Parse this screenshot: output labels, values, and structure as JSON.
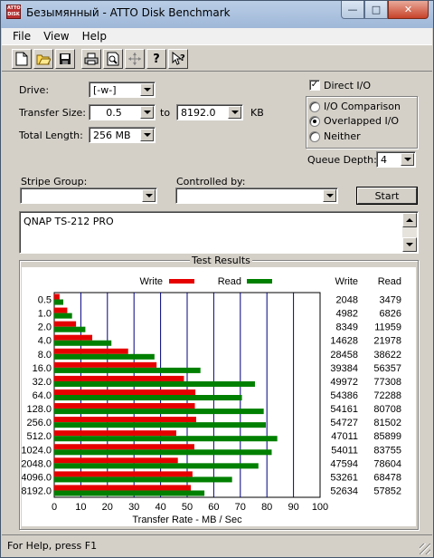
{
  "window": {
    "title": "Безымянный - ATTO Disk Benchmark",
    "icon_text": "ATTO DISK"
  },
  "menu": [
    "File",
    "View",
    "Help"
  ],
  "toolbar": {
    "buttons": [
      "new-icon",
      "open-icon",
      "save-icon",
      "print-icon",
      "print-preview-icon",
      "move-icon",
      "help-icon",
      "context-help-icon"
    ]
  },
  "settings": {
    "drive_label": "Drive:",
    "drive_value": "[-w-]",
    "transfer_size_label": "Transfer Size:",
    "transfer_from": "0.5",
    "to_label": "to",
    "transfer_to": "8192.0",
    "kb_label": "KB",
    "total_length_label": "Total Length:",
    "total_length_value": "256 MB",
    "direct_io_label": "Direct I/O",
    "direct_io_checked": true,
    "io_comparison_label": "I/O Comparison",
    "overlapped_io_label": "Overlapped I/O",
    "neither_label": "Neither",
    "selected_mode": "overlapped",
    "queue_depth_label": "Queue Depth:",
    "queue_depth_value": "4",
    "stripe_group_label": "Stripe Group:",
    "stripe_group_value": "",
    "controlled_by_label": "Controlled by:",
    "controlled_by_value": "",
    "start_label": "Start",
    "description": "QNAP TS-212 PRO"
  },
  "results": {
    "group_title": "Test Results",
    "write_legend": "Write",
    "read_legend": "Read",
    "write_col": "Write",
    "read_col": "Read",
    "axis_label": "Transfer Rate - MB / Sec"
  },
  "chart_data": {
    "type": "bar",
    "orientation": "horizontal",
    "categories": [
      "0.5",
      "1.0",
      "2.0",
      "4.0",
      "8.0",
      "16.0",
      "32.0",
      "64.0",
      "128.0",
      "256.0",
      "512.0",
      "1024.0",
      "2048.0",
      "4096.0",
      "8192.0"
    ],
    "series": [
      {
        "name": "Write",
        "color": "#e60000",
        "values": [
          2048,
          4982,
          8349,
          14628,
          28458,
          39384,
          49972,
          54386,
          54161,
          54727,
          47011,
          54011,
          47594,
          53261,
          52634
        ]
      },
      {
        "name": "Read",
        "color": "#008000",
        "values": [
          3479,
          6826,
          11959,
          21978,
          38622,
          56357,
          77308,
          72288,
          80708,
          81502,
          85899,
          83755,
          78604,
          68478,
          57852
        ]
      }
    ],
    "bar_values_mb": {
      "Write": [
        2.0,
        4.9,
        8.2,
        14.3,
        27.8,
        38.5,
        48.8,
        53.1,
        52.9,
        53.4,
        45.9,
        52.7,
        46.5,
        52.0,
        51.4
      ],
      "Read": [
        3.4,
        6.7,
        11.7,
        21.5,
        37.7,
        55.0,
        75.5,
        70.6,
        78.8,
        79.6,
        83.9,
        81.8,
        76.8,
        66.9,
        56.5
      ]
    },
    "xticks": [
      0,
      10,
      20,
      30,
      40,
      50,
      60,
      70,
      80,
      90,
      100
    ],
    "xlim": [
      0,
      100
    ],
    "grid": true,
    "colors": {
      "write": "#e60000",
      "read": "#008000",
      "grid": "#000080"
    }
  },
  "status": {
    "text": "For Help, press F1"
  }
}
